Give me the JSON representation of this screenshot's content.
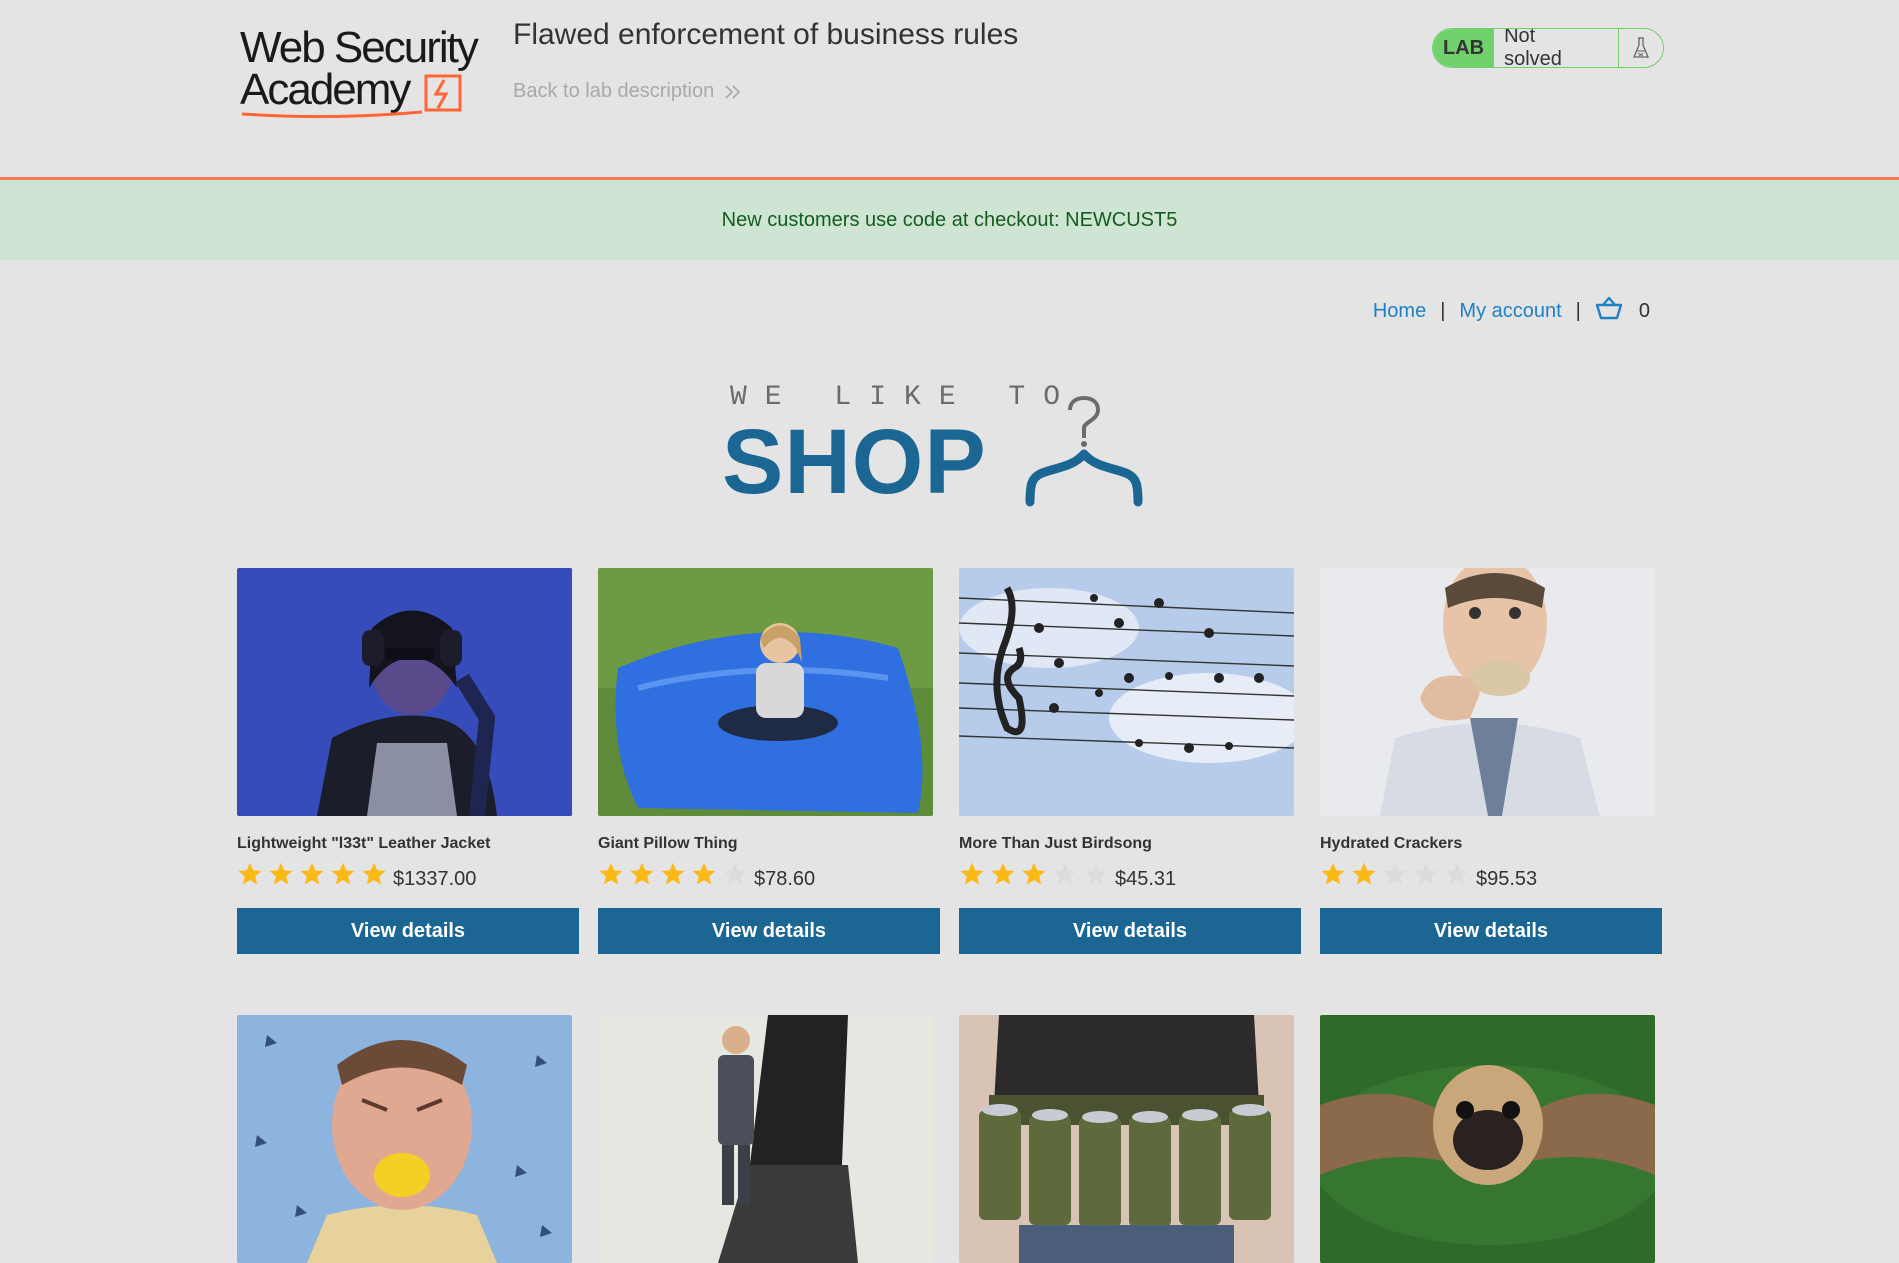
{
  "header": {
    "logo_line1": "Web Security",
    "logo_line2": "Academy",
    "lab_title": "Flawed enforcement of business rules",
    "back_link": "Back to lab description",
    "lab_badge": "LAB",
    "lab_status": "Not solved"
  },
  "notice": "New customers use code at checkout: NEWCUST5",
  "nav": {
    "home": "Home",
    "separator": "|",
    "my_account": "My account",
    "cart_count": "0"
  },
  "banner": {
    "subtitle": "WE LIKE TO",
    "title": "SHOP"
  },
  "products": [
    {
      "name": "Lightweight \"l33t\" Leather Jacket",
      "price": "$1337.00",
      "rating": 5,
      "button": "View details"
    },
    {
      "name": "Giant Pillow Thing",
      "price": "$78.60",
      "rating": 4,
      "button": "View details"
    },
    {
      "name": "More Than Just Birdsong",
      "price": "$45.31",
      "rating": 3,
      "button": "View details"
    },
    {
      "name": "Hydrated Crackers",
      "price": "$95.53",
      "rating": 2,
      "button": "View details"
    }
  ],
  "colors": {
    "accent_blue": "#1b6693",
    "link_blue": "#1f81c5",
    "lab_green": "#70d16d",
    "orange": "#ff6633",
    "star_gold": "#fbb917",
    "star_empty": "#dcdcdc"
  }
}
